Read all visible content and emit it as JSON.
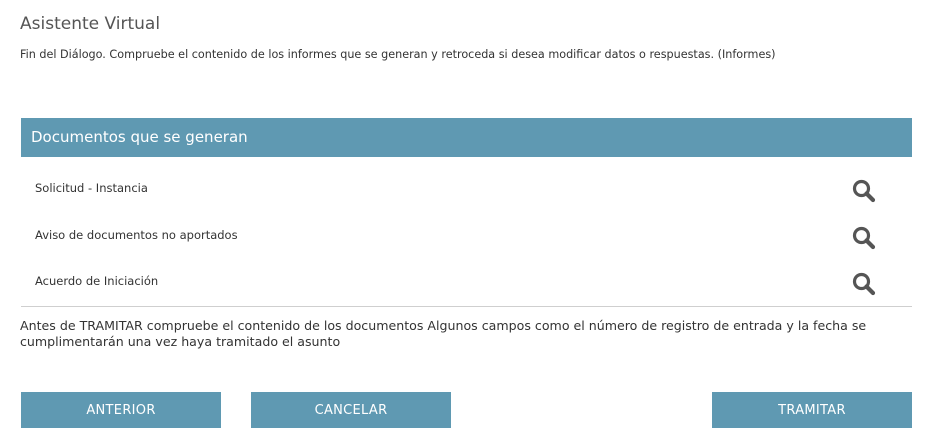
{
  "page": {
    "title": "Asistente Virtual",
    "subtitle": "Fin del Diálogo. Compruebe el contenido de los informes que se generan y retroceda si desea modificar datos o respuestas. (Informes)"
  },
  "documents": {
    "header": "Documentos que se generan",
    "items": [
      {
        "label": "Solicitud - Instancia",
        "icon": "search-icon"
      },
      {
        "label": "Aviso de documentos no aportados",
        "icon": "search-icon"
      },
      {
        "label": "Acuerdo de Iniciación",
        "icon": "search-icon"
      }
    ]
  },
  "note": {
    "text": "Antes de TRAMITAR compruebe el contenido de los documentos  Algunos campos como el número de registro de entrada y la fecha se cumplimentarán una vez haya tramitado el asunto"
  },
  "buttons": {
    "anterior": "ANTERIOR",
    "cancelar": "CANCELAR",
    "tramitar": "TRAMITAR"
  },
  "colors": {
    "accent": "#5f99b2",
    "icon": "#555555"
  }
}
